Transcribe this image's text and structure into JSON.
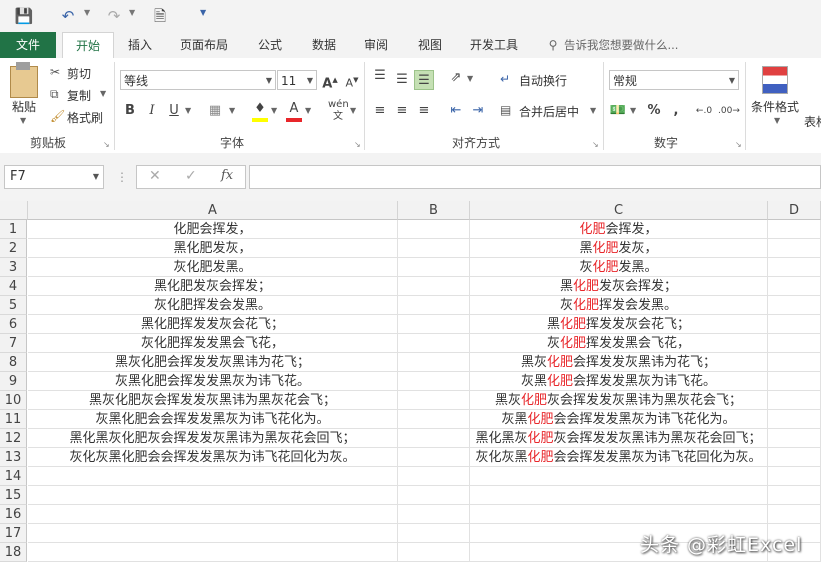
{
  "quick_access": {
    "icons": [
      "save-icon",
      "undo-icon",
      "redo-icon",
      "print-preview-icon",
      "customize-icon"
    ]
  },
  "tabs": [
    {
      "id": "file",
      "label": "文件"
    },
    {
      "id": "home",
      "label": "开始"
    },
    {
      "id": "insert",
      "label": "插入"
    },
    {
      "id": "layout",
      "label": "页面布局"
    },
    {
      "id": "formula",
      "label": "公式"
    },
    {
      "id": "data",
      "label": "数据"
    },
    {
      "id": "review",
      "label": "审阅"
    },
    {
      "id": "view",
      "label": "视图"
    },
    {
      "id": "developer",
      "label": "开发工具"
    }
  ],
  "tell_me": "告诉我您想要做什么...",
  "ribbon": {
    "paste": "粘贴",
    "cut": "剪切",
    "copy": "复制",
    "format_painter": "格式刷",
    "clipboard_label": "剪贴板",
    "font_name": "等线",
    "font_size": "11",
    "font_label": "字体",
    "wrap_text": "自动换行",
    "merge_center": "合并后居中",
    "align_label": "对齐方式",
    "number_format": "常规",
    "number_label": "数字",
    "cond_format": "条件格式",
    "table_partial": "表格",
    "accent_green": "#217346",
    "font_color": "#e8262a",
    "highlight_color": "#ffff00"
  },
  "namebox": "F7",
  "fx": "fx",
  "columns": [
    "A",
    "B",
    "C",
    "D"
  ],
  "rows": [
    {
      "n": "1",
      "a": "化肥会挥发，",
      "c": {
        "pre": "",
        "red": "化肥",
        "post": "会挥发，"
      }
    },
    {
      "n": "2",
      "a": "黑化肥发灰，",
      "c": {
        "pre": "黑",
        "red": "化肥",
        "post": "发灰，"
      }
    },
    {
      "n": "3",
      "a": "灰化肥发黑。",
      "c": {
        "pre": "灰",
        "red": "化肥",
        "post": "发黑。"
      }
    },
    {
      "n": "4",
      "a": "黑化肥发灰会挥发；",
      "c": {
        "pre": "黑",
        "red": "化肥",
        "post": "发灰会挥发；"
      }
    },
    {
      "n": "5",
      "a": "灰化肥挥发会发黑。",
      "c": {
        "pre": "灰",
        "red": "化肥",
        "post": "挥发会发黑。"
      }
    },
    {
      "n": "6",
      "a": "黑化肥挥发发灰会花飞；",
      "c": {
        "pre": "黑",
        "red": "化肥",
        "post": "挥发发灰会花飞；"
      }
    },
    {
      "n": "7",
      "a": "灰化肥挥发发黑会飞花，",
      "c": {
        "pre": "灰",
        "red": "化肥",
        "post": "挥发发黑会飞花，"
      }
    },
    {
      "n": "8",
      "a": "黑灰化肥会挥发发灰黑讳为花飞；",
      "c": {
        "pre": "黑灰",
        "red": "化肥",
        "post": "会挥发发灰黑讳为花飞；"
      }
    },
    {
      "n": "9",
      "a": "灰黑化肥会挥发发黑灰为讳飞花。",
      "c": {
        "pre": "灰黑",
        "red": "化肥",
        "post": "会挥发发黑灰为讳飞花。"
      }
    },
    {
      "n": "10",
      "a": "黑灰化肥灰会挥发发灰黑讳为黑灰花会飞；",
      "c": {
        "pre": "黑灰",
        "red": "化肥",
        "post": "灰会挥发发灰黑讳为黑灰花会飞；"
      }
    },
    {
      "n": "11",
      "a": "灰黑化肥会会挥发发黑灰为讳飞花化为。",
      "c": {
        "pre": "灰黑",
        "red": "化肥",
        "post": "会会挥发发黑灰为讳飞花化为。"
      }
    },
    {
      "n": "12",
      "a": "黑化黑灰化肥灰会挥发发灰黑讳为黑灰花会回飞；",
      "c": {
        "pre": "黑化黑灰",
        "red": "化肥",
        "post": "灰会挥发发灰黑讳为黑灰花会回飞；"
      }
    },
    {
      "n": "13",
      "a": "灰化灰黑化肥会会挥发发黑灰为讳飞花回化为灰。",
      "c": {
        "pre": "灰化灰黑",
        "red": "化肥",
        "post": "会会挥发发黑灰为讳飞花回化为灰。"
      }
    },
    {
      "n": "14"
    },
    {
      "n": "15"
    },
    {
      "n": "16"
    },
    {
      "n": "17"
    },
    {
      "n": "18"
    }
  ],
  "watermark": "头条 @彩虹Excel"
}
